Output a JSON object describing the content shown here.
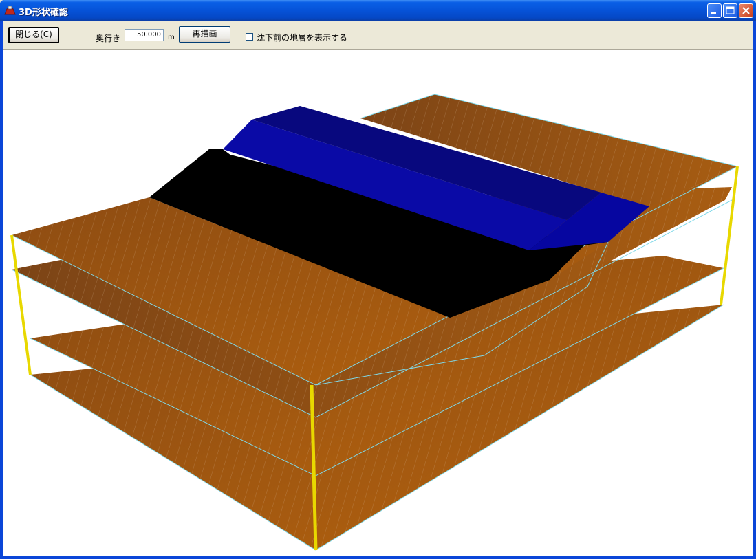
{
  "window": {
    "title": "3D形状確認",
    "app_icon": "terrain-app-icon",
    "controls": {
      "minimize": "minimize-icon",
      "maximize": "maximize-icon",
      "close": "close-icon"
    }
  },
  "toolbar": {
    "close_label": "閉じる(C)",
    "depth_label": "奥行き",
    "depth_value": "50.000",
    "depth_unit": "m",
    "redraw_label": "再描画",
    "show_pre_settlement_label": "沈下前の地層を表示する",
    "show_pre_settlement_checked": false
  },
  "colors": {
    "soil_layer": "#a65a12",
    "embankment_top": "#0a0a9a",
    "embankment_slope": "#000000",
    "edge_lines": "#7fd8e8",
    "corner_posts": "#e8d800"
  }
}
